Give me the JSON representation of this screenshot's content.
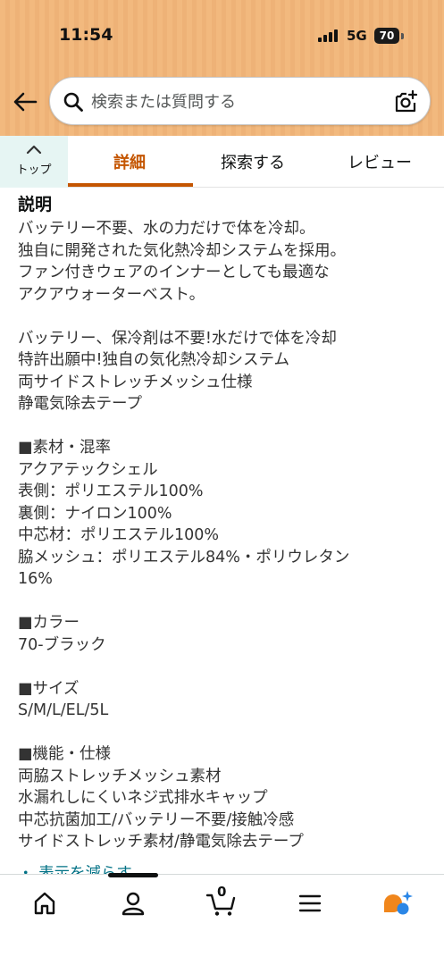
{
  "status_bar": {
    "time": "11:54",
    "network": "5G",
    "battery": "70"
  },
  "search": {
    "placeholder": "検索または質問する"
  },
  "tabs": {
    "top_label": "トップ",
    "items": [
      {
        "label": "詳細"
      },
      {
        "label": "探索する"
      },
      {
        "label": "レビュー"
      }
    ]
  },
  "description": {
    "title": "説明",
    "lines": [
      "バッテリー不要、水の力だけで体を冷却。",
      "独自に開発された気化熱冷却システムを採用。",
      "ファン付きウェアのインナーとしても最適な",
      "アクアウォーターベスト。",
      "",
      "バッテリー、保冷剤は不要!水だけで体を冷却",
      "特許出願中!独自の気化熱冷却システム",
      "両サイドストレッチメッシュ仕様",
      "静電気除去テープ",
      "",
      "■素材・混率",
      "アクアテックシェル",
      "表側：ポリエステル100%",
      "裏側：ナイロン100%",
      "中芯材：ポリエステル100%",
      "脇メッシュ：ポリエステル84%・ポリウレタン",
      "16%",
      "",
      "■カラー",
      "70-ブラック",
      "",
      "■サイズ",
      "S/M/L/EL/5L",
      "",
      "■機能・仕様",
      "両脇ストレッチメッシュ素材",
      "水漏れしにくいネジ式排水キャップ",
      "中芯抗菌加工/バッテリー不要/接触冷感",
      "サイドストレッチ素材/静電気除去テープ"
    ],
    "show_less": "・ 表示を減らす"
  },
  "bottom_nav": {
    "cart_count": "0",
    "items": [
      "home-icon",
      "account-icon",
      "cart-icon",
      "menu-icon",
      "rufus-icon"
    ]
  },
  "colors": {
    "header": "#f2b97e",
    "accent": "#c45500",
    "link": "#007185",
    "top_button_bg": "#e6f5f3"
  }
}
